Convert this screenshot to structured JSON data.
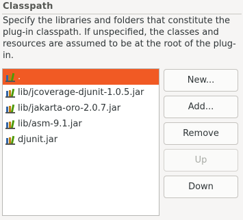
{
  "section": {
    "title": "Classpath",
    "description": "Specify the libraries and folders that constitute the plug-in classpath.  If unspecified, the classes and resources are assumed to be at the root of the plug-in."
  },
  "classpath": {
    "items": [
      {
        "label": ".",
        "selected": true,
        "icon": "library-jar-icon"
      },
      {
        "label": "lib/jcoverage-djunit-1.0.5.jar",
        "selected": false,
        "icon": "library-jar-icon"
      },
      {
        "label": "lib/jakarta-oro-2.0.7.jar",
        "selected": false,
        "icon": "library-jar-icon"
      },
      {
        "label": "lib/asm-9.1.jar",
        "selected": false,
        "icon": "library-jar-icon"
      },
      {
        "label": "djunit.jar",
        "selected": false,
        "icon": "library-jar-icon"
      }
    ]
  },
  "buttons": {
    "new_label": "New...",
    "add_label": "Add...",
    "remove_label": "Remove",
    "up_label": "Up",
    "down_label": "Down"
  },
  "colors": {
    "selection": "#f15a24",
    "icon_book_blue": "#3465a4",
    "icon_book_orange": "#c17d11",
    "icon_book_green": "#4e9a06"
  }
}
